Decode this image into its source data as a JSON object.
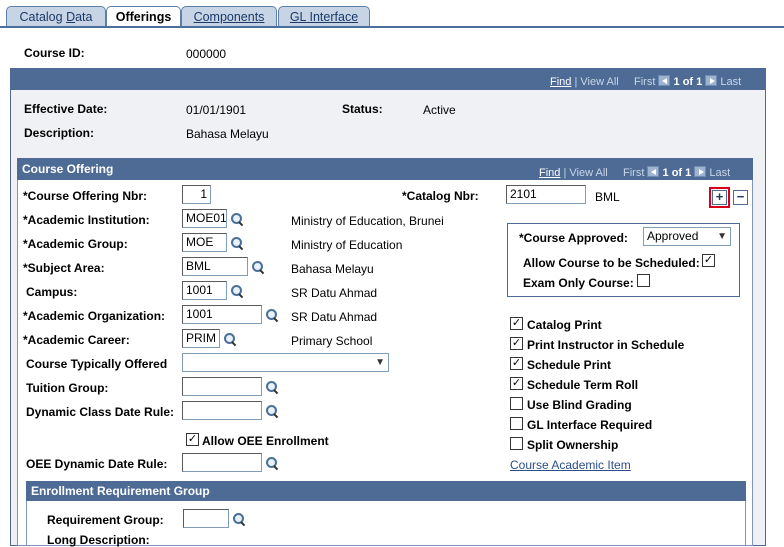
{
  "tabs": [
    {
      "label": "Catalog Data",
      "u": "D"
    },
    {
      "label": "Offerings"
    },
    {
      "label": "Components"
    },
    {
      "label": "GL Interface"
    }
  ],
  "course": {
    "id_label": "Course ID:",
    "id_value": "000000"
  },
  "main_nav": {
    "find": "Find",
    "view_all": "View All",
    "first": "First",
    "counter": "1 of 1",
    "last": "Last"
  },
  "effective": {
    "date_label": "Effective Date:",
    "date_value": "01/01/1901",
    "status_label": "Status:",
    "status_value": "Active",
    "desc_label": "Description:",
    "desc_value": "Bahasa Melayu"
  },
  "offering": {
    "title": "Course Offering",
    "nav": {
      "find": "Find",
      "view_all": "View All",
      "first": "First",
      "counter": "1 of 1",
      "last": "Last"
    },
    "offering_nbr_label": "*Course Offering Nbr:",
    "offering_nbr_value": "1",
    "catalog_nbr_label": "*Catalog Nbr:",
    "catalog_nbr_value": "2101",
    "catalog_desc": "BML",
    "institution_label": "*Academic Institution:",
    "institution_value": "MOE01",
    "institution_desc": "Ministry of Education, Brunei",
    "group_label": "*Academic Group:",
    "group_value": "MOE",
    "group_desc": "Ministry of Education",
    "subject_label": "*Subject Area:",
    "subject_value": "BML",
    "subject_desc": "Bahasa Melayu",
    "campus_label": "Campus:",
    "campus_value": "1001",
    "campus_desc": "SR Datu Ahmad",
    "org_label": "*Academic Organization:",
    "org_value": "1001",
    "org_desc": "SR Datu Ahmad",
    "career_label": "*Academic Career:",
    "career_value": "PRIM",
    "career_desc": "Primary School",
    "typically_offered_label": "Course Typically Offered",
    "typically_offered_value": "",
    "tuition_label": "Tuition Group:",
    "tuition_value": "",
    "dynamic_rule_label": "Dynamic Class Date Rule:",
    "dynamic_rule_value": "",
    "allow_oee_label": "Allow OEE Enrollment",
    "allow_oee_checked": true,
    "oee_rule_label": "OEE Dynamic Date Rule:",
    "oee_rule_value": "",
    "approved_label": "*Course Approved:",
    "approved_value": "Approved",
    "allow_schedule_label": "Allow Course to be Scheduled:",
    "allow_schedule_checked": true,
    "exam_only_label": "Exam Only Course:",
    "exam_only_checked": false,
    "checkboxes": [
      {
        "label": "Catalog Print",
        "checked": true
      },
      {
        "label": "Print Instructor in Schedule",
        "checked": true
      },
      {
        "label": "Schedule Print",
        "checked": true
      },
      {
        "label": "Schedule Term Roll",
        "checked": true
      },
      {
        "label": "Use Blind Grading",
        "checked": false
      },
      {
        "label": "GL Interface Required",
        "checked": false
      },
      {
        "label": "Split Ownership",
        "checked": false
      }
    ],
    "academic_item_link": "Course Academic Item",
    "add_symbol": "+",
    "remove_symbol": "−",
    "check_mark": "✓"
  },
  "enrollment": {
    "title": "Enrollment Requirement Group",
    "req_group_label": "Requirement Group:",
    "req_group_value": "",
    "long_desc_label": "Long Description:"
  }
}
